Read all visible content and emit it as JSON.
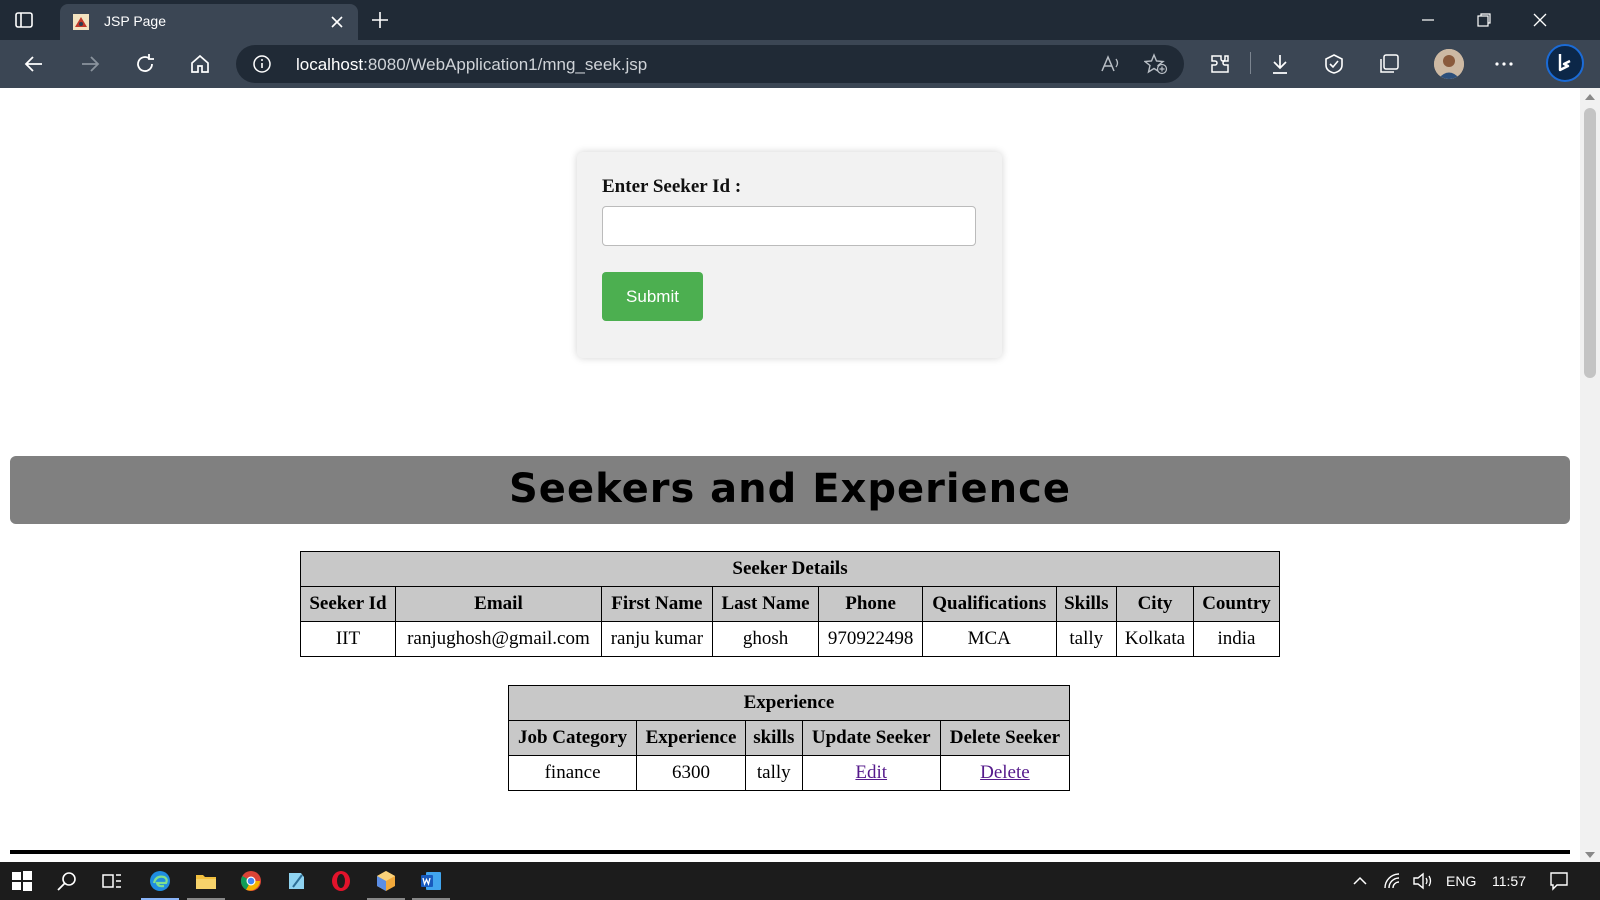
{
  "browser": {
    "tab_title": "JSP Page",
    "url_host": "localhost",
    "url_rest": ":8080/WebApplication1/mng_seek.jsp"
  },
  "form": {
    "label": "Enter Seeker Id :",
    "input_value": "",
    "submit_label": "Submit"
  },
  "banner": {
    "title": "Seekers and Experience"
  },
  "seeker_table": {
    "caption": "Seeker Details",
    "headers": [
      "Seeker Id",
      "Email",
      "First Name",
      "Last Name",
      "Phone",
      "Qualifications",
      "Skills",
      "City",
      "Country"
    ],
    "rows": [
      [
        "IIT",
        "ranjughosh@gmail.com",
        "ranju kumar",
        "ghosh",
        "970922498",
        "MCA",
        "tally",
        "Kolkata",
        "india"
      ]
    ]
  },
  "experience_table": {
    "caption": "Experience",
    "headers": [
      "Job Category",
      "Experience",
      "skills",
      "Update Seeker",
      "Delete Seeker"
    ],
    "rows": [
      {
        "job_category": "finance",
        "experience": "6300",
        "skills": "tally",
        "edit": "Edit",
        "delete": "Delete"
      }
    ]
  },
  "taskbar": {
    "language": "ENG",
    "time": "11:57"
  },
  "colors": {
    "submit": "#4caf50",
    "banner": "#808080",
    "link": "#551a8b",
    "chrome": "#3b4654"
  }
}
